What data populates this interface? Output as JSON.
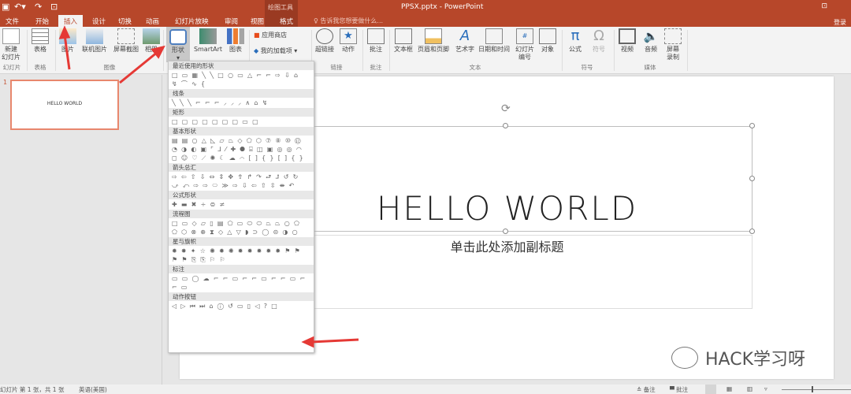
{
  "titlebar": {
    "doc_title": "PPSX.pptx - PowerPoint",
    "context_group": "绘图工具",
    "login": "登录",
    "quick_access": [
      "save-icon",
      "undo-icon",
      "redo-icon",
      "present-icon"
    ]
  },
  "tabs": [
    {
      "label": "文件"
    },
    {
      "label": "开始"
    },
    {
      "label": "插入",
      "active": true
    },
    {
      "label": "设计"
    },
    {
      "label": "切换"
    },
    {
      "label": "动画"
    },
    {
      "label": "幻灯片放映"
    },
    {
      "label": "审阅"
    },
    {
      "label": "视图"
    },
    {
      "label": "格式"
    }
  ],
  "tellme": "♀ 告诉我您想要做什么...",
  "ribbon": {
    "buttons": {
      "new_slide": "新建\n幻灯片",
      "table": "表格",
      "picture": "图片",
      "online_picture": "联机图片",
      "screenshot": "屏幕截图",
      "album": "相册",
      "shapes": "形状",
      "smartart": "SmartArt",
      "chart": "图表",
      "store": "应用商店",
      "my_addins": "我的加载项",
      "hyperlink": "超链接",
      "action": "动作",
      "comment": "批注",
      "textbox": "文本框",
      "header_footer": "页眉和页脚",
      "wordart": "艺术字",
      "datetime": "日期和时间",
      "slide_number": "幻灯片\n编号",
      "object": "对象",
      "equation": "公式",
      "symbol": "符号",
      "video": "视频",
      "audio": "音频",
      "screen_record": "屏幕\n录制"
    },
    "groups": {
      "slides": "幻灯片",
      "tables": "表格",
      "images": "图像",
      "links": "链接",
      "comments": "批注",
      "text": "文本",
      "symbols": "符号",
      "media": "媒体"
    }
  },
  "shapes_menu": {
    "sections": [
      {
        "title": "最近使用的形状",
        "glyphs": "□▭▦╲╲□○▭△⌐⌐⇨⇩⌂↯⌒∿{"
      },
      {
        "title": "线条",
        "glyphs": "╲╲╲⌐⌐⌐⸝⸝⸝∧⌂↯"
      },
      {
        "title": "矩形",
        "glyphs": "□▢▢▢▢▢▢▭▢"
      },
      {
        "title": "基本形状",
        "glyphs": "▤▤○△◺▱⏢◇⬠⬡⑦⑧⑩⑫◔◑◐▣⌜⅃⁄✚⯃⌸◫▣◎◎◠◻☺♡⟋✺☾☁⌒[]{}[]{}"
      },
      {
        "title": "箭头总汇",
        "glyphs": "⇨⇦⇧⇩⇔⇕✥⇮↱↷⮐⮥↺↻⤻⤺⇨⇨⬭≫⇨⇩⇦⇧⇳⇼↶"
      },
      {
        "title": "公式形状",
        "glyphs": "✚▬✖÷⊜≠"
      },
      {
        "title": "流程图",
        "glyphs": "□▭◇▱▯▤⬠▭⬭⬭⏢⏢○⬠⬠⬡⊗⊕⧗◇△▽◗⊃◯⊝◑○"
      },
      {
        "title": "星与旗帜",
        "glyphs": "✹✸✦☆✺✹✺✹✹✹✹✹⚑⚑⚑⚑⎘⎘⚐⚐"
      },
      {
        "title": "标注",
        "glyphs": "▭▭◯☁⌐⌐▭⌐⌐▭⌐⌐▭⌐⌐▭"
      },
      {
        "title": "动作按钮",
        "glyphs": "◁▷⏮⏭⌂ⓘ↺▭▯◁?□"
      }
    ]
  },
  "slide_panel": {
    "number": "1",
    "thumb_text": "HELLO WORLD"
  },
  "slide": {
    "title": "HELLO WORLD",
    "subtitle": "单击此处添加副标题"
  },
  "watermark": "HACK学习呀",
  "status": {
    "slide_info": "幻灯片 第 1 张，共 1 张",
    "language": "英语(美国)",
    "notes": "≙ 备注",
    "comments": "▀ 批注"
  },
  "annotation_color": "#e53935",
  "accent": "#b7472a"
}
